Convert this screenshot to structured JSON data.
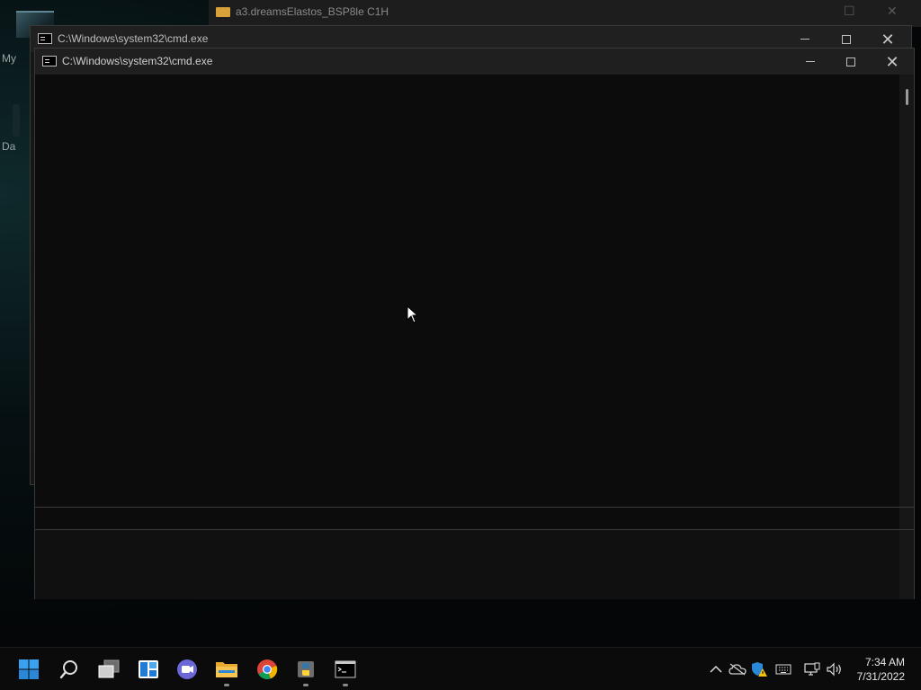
{
  "desktop": {
    "labels": [
      "My",
      "Da"
    ]
  },
  "background_window": {
    "title": "a3.dreamsElastos_BSP8le C1H"
  },
  "cmd_back": {
    "title": "C:\\Windows\\system32\\cmd.exe"
  },
  "cmd_front": {
    "title": "C:\\Windows\\system32\\cmd.exe"
  },
  "taskbar": {
    "apps": [
      {
        "name": "start",
        "icon": "windows-logo-icon"
      },
      {
        "name": "search",
        "icon": "search-icon"
      },
      {
        "name": "task-view",
        "icon": "task-view-icon"
      },
      {
        "name": "widgets",
        "icon": "widgets-icon"
      },
      {
        "name": "chat",
        "icon": "teams-chat-icon"
      },
      {
        "name": "file-explorer",
        "icon": "folder-icon"
      },
      {
        "name": "chrome",
        "icon": "chrome-icon"
      },
      {
        "name": "python",
        "icon": "python-icon"
      },
      {
        "name": "terminal",
        "icon": "cmd-icon"
      }
    ],
    "time": "7:34 AM",
    "date": "7/31/2022"
  },
  "colors": {
    "accent": "#2b88d8",
    "console_bg": "#0c0c0c",
    "taskbar_bg": "#0b0b0b"
  }
}
